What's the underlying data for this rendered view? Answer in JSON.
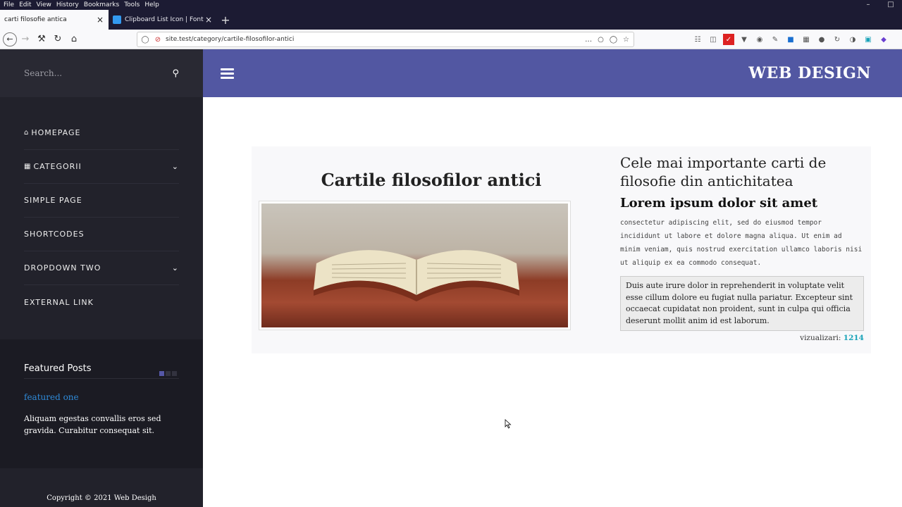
{
  "browser": {
    "menu": [
      "File",
      "Edit",
      "View",
      "History",
      "Bookmarks",
      "Tools",
      "Help"
    ],
    "tabs": [
      {
        "title": "carti filosofie antica"
      },
      {
        "title": "Clipboard List Icon | Font Awe"
      }
    ],
    "url": "site.test/category/cartile-filosofilor-antici"
  },
  "sidebar": {
    "search_placeholder": "Search...",
    "nav": [
      {
        "label": "HOMEPAGE",
        "icon": "home-icon"
      },
      {
        "label": "CATEGORII",
        "icon": "clipboard-icon"
      },
      {
        "label": "SIMPLE PAGE"
      },
      {
        "label": "SHORTCODES"
      },
      {
        "label": "DROPDOWN TWO"
      },
      {
        "label": "EXTERNAL LINK"
      }
    ],
    "featured": {
      "title": "Featured Posts",
      "link": "featured one",
      "text": "Aliquam egestas convallis eros sed gravida. Curabitur consequat sit."
    },
    "copyright": "Copyright © 2021 Web Desigh"
  },
  "header": {
    "brand": "WEB DESIGN"
  },
  "post": {
    "title": "Cartile filosofilor antici",
    "heading": "Cele mai importante carti de filosofie din antichitatea",
    "subheading": "Lorem ipsum dolor sit amet",
    "body": "consectetur adipiscing elit, sed do eiusmod tempor incididunt ut labore et dolore magna aliqua. Ut enim ad minim veniam, quis nostrud exercitation ullamco laboris nisi ut aliquip ex ea commodo consequat.",
    "quote": "Duis aute irure dolor in reprehenderit in voluptate velit esse cillum dolore eu fugiat nulla pariatur. Excepteur sint occaecat cupidatat non proident, sunt in culpa qui officia deserunt mollit anim id est laborum.",
    "views_label": "vizualizari:",
    "views_count": "1214"
  }
}
